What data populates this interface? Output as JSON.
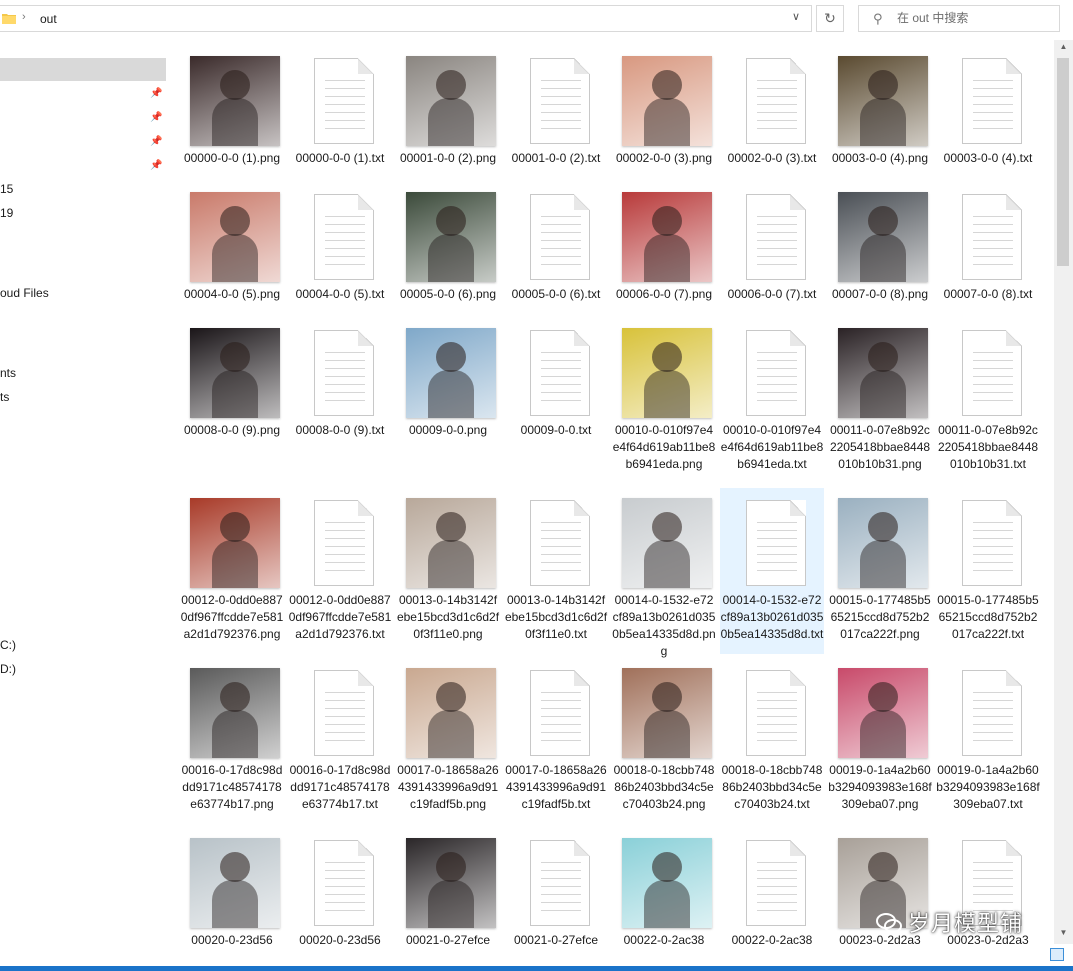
{
  "address_bar": {
    "crumb": "out"
  },
  "search": {
    "placeholder": "在 out 中搜索"
  },
  "nav": {
    "labels": [
      {
        "text": "15",
        "row": 0
      },
      {
        "text": "19",
        "row": 1
      },
      {
        "text": "oud Files",
        "row": 2
      },
      {
        "text": "nts",
        "row": 3
      },
      {
        "text": "ts",
        "row": 4
      },
      {
        "text": "C:)",
        "row": 5
      },
      {
        "text": "D:)",
        "row": 6
      }
    ]
  },
  "files": [
    {
      "name": "00000-0-0 (1).png",
      "type": "png",
      "color": "#3a2a2a"
    },
    {
      "name": "00000-0-0 (1).txt",
      "type": "txt"
    },
    {
      "name": "00001-0-0 (2).png",
      "type": "png",
      "color": "#8a8580"
    },
    {
      "name": "00001-0-0 (2).txt",
      "type": "txt"
    },
    {
      "name": "00002-0-0 (3).png",
      "type": "png",
      "color": "#d89880"
    },
    {
      "name": "00002-0-0 (3).txt",
      "type": "txt"
    },
    {
      "name": "00003-0-0 (4).png",
      "type": "png",
      "color": "#5a4a30"
    },
    {
      "name": "00003-0-0 (4).txt",
      "type": "txt"
    },
    {
      "name": "00004-0-0 (5).png",
      "type": "png",
      "color": "#c97a6a"
    },
    {
      "name": "00004-0-0 (5).txt",
      "type": "txt"
    },
    {
      "name": "00005-0-0 (6).png",
      "type": "png",
      "color": "#3b4a3a"
    },
    {
      "name": "00005-0-0 (6).txt",
      "type": "txt"
    },
    {
      "name": "00006-0-0 (7).png",
      "type": "png",
      "color": "#b83a3a"
    },
    {
      "name": "00006-0-0 (7).txt",
      "type": "txt"
    },
    {
      "name": "00007-0-0 (8).png",
      "type": "png",
      "color": "#4a4f55"
    },
    {
      "name": "00007-0-0 (8).txt",
      "type": "txt"
    },
    {
      "name": "00008-0-0 (9).png",
      "type": "png",
      "color": "#1a1518"
    },
    {
      "name": "00008-0-0 (9).txt",
      "type": "txt"
    },
    {
      "name": "00009-0-0.png",
      "type": "png",
      "color": "#7fa8c9"
    },
    {
      "name": "00009-0-0.txt",
      "type": "txt"
    },
    {
      "name": "00010-0-010f97e4e4f64d619ab11be8b6941eda.png",
      "type": "png",
      "color": "#d8c23a"
    },
    {
      "name": "00010-0-010f97e4e4f64d619ab11be8b6941eda.txt",
      "type": "txt"
    },
    {
      "name": "00011-0-07e8b92c2205418bbae8448010b10b31.png",
      "type": "png",
      "color": "#2a2225"
    },
    {
      "name": "00011-0-07e8b92c2205418bbae8448010b10b31.txt",
      "type": "txt"
    },
    {
      "name": "00012-0-0dd0e8870df967ffcdde7e581a2d1d792376.png",
      "type": "png",
      "color": "#a83a28"
    },
    {
      "name": "00012-0-0dd0e8870df967ffcdde7e581a2d1d792376.txt",
      "type": "txt"
    },
    {
      "name": "00013-0-14b3142febe15bcd3d1c6d2f0f3f11e0.png",
      "type": "png",
      "color": "#b8a89a"
    },
    {
      "name": "00013-0-14b3142febe15bcd3d1c6d2f0f3f11e0.txt",
      "type": "txt"
    },
    {
      "name": "00014-0-1532-e72cf89a13b0261d0350b5ea14335d8d.png",
      "type": "png",
      "color": "#c8cccf"
    },
    {
      "name": "00014-0-1532-e72cf89a13b0261d0350b5ea14335d8d.txt",
      "type": "txt",
      "selected": true
    },
    {
      "name": "00015-0-177485b565215ccd8d752b2017ca222f.png",
      "type": "png",
      "color": "#9ab0c0"
    },
    {
      "name": "00015-0-177485b565215ccd8d752b2017ca222f.txt",
      "type": "txt"
    },
    {
      "name": "00016-0-17d8c98ddd9171c48574178e63774b17.png",
      "type": "png",
      "color": "#5a5a5a"
    },
    {
      "name": "00016-0-17d8c98ddd9171c48574178e63774b17.txt",
      "type": "txt"
    },
    {
      "name": "00017-0-18658a264391433996a9d91c19fadf5b.png",
      "type": "png",
      "color": "#c9a890"
    },
    {
      "name": "00017-0-18658a264391433996a9d91c19fadf5b.txt",
      "type": "txt"
    },
    {
      "name": "00018-0-18cbb74886b2403bbd34c5ec70403b24.png",
      "type": "png",
      "color": "#a0705a"
    },
    {
      "name": "00018-0-18cbb74886b2403bbd34c5ec70403b24.txt",
      "type": "txt"
    },
    {
      "name": "00019-0-1a4a2b60b3294093983e168f309eba07.png",
      "type": "png",
      "color": "#c84a6a"
    },
    {
      "name": "00019-0-1a4a2b60b3294093983e168f309eba07.txt",
      "type": "txt"
    },
    {
      "name": "00020-0-23d56",
      "type": "png",
      "color": "#b8c2c8"
    },
    {
      "name": "00020-0-23d56",
      "type": "txt"
    },
    {
      "name": "00021-0-27efce",
      "type": "png",
      "color": "#2a2628"
    },
    {
      "name": "00021-0-27efce",
      "type": "txt"
    },
    {
      "name": "00022-0-2ac38",
      "type": "png",
      "color": "#8ad0d8"
    },
    {
      "name": "00022-0-2ac38",
      "type": "txt"
    },
    {
      "name": "00023-0-2d2a3",
      "type": "png",
      "color": "#a8a098"
    },
    {
      "name": "00023-0-2d2a3",
      "type": "txt"
    }
  ],
  "watermark": {
    "text": "岁月模型铺"
  }
}
